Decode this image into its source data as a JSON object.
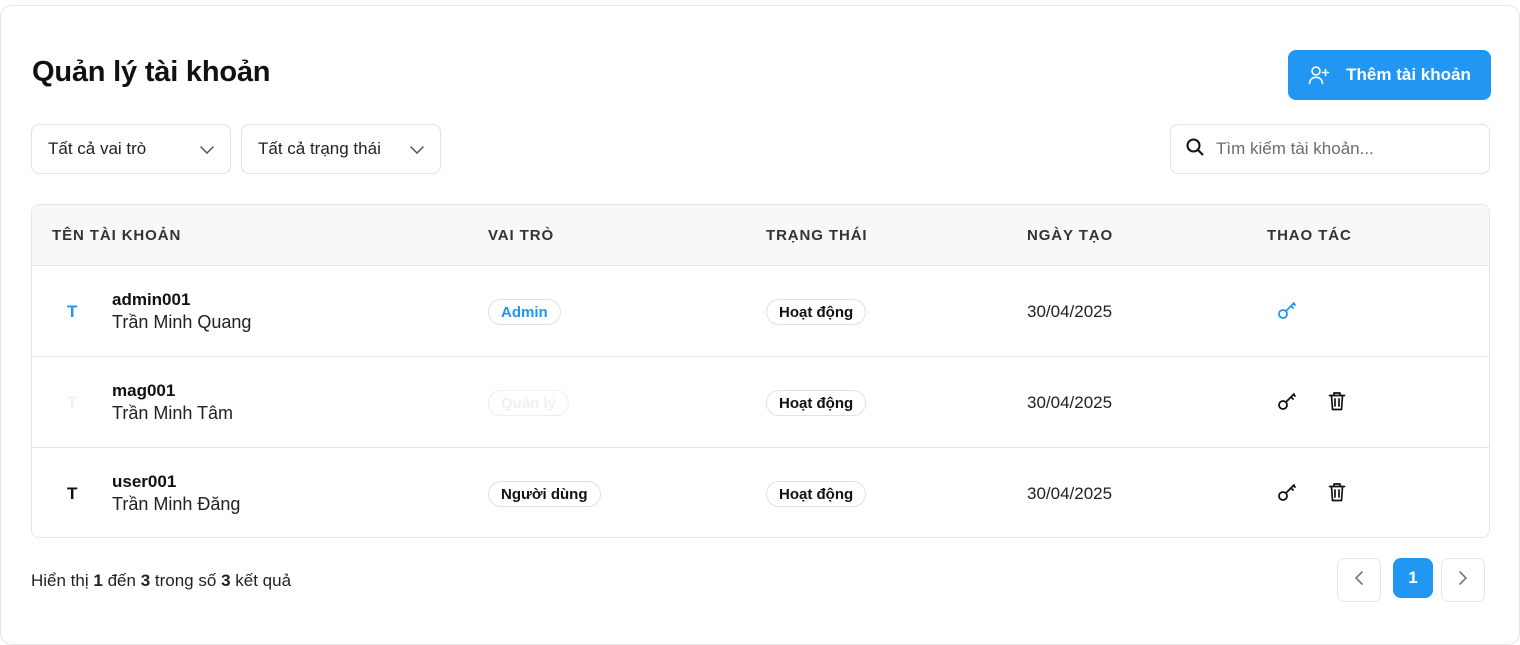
{
  "page": {
    "title": "Quản lý tài khoản",
    "add_button": "Thêm tài khoản"
  },
  "filters": {
    "role": "Tất cả vai trò",
    "status": "Tất cả trạng thái"
  },
  "search": {
    "placeholder": "Tìm kiếm tài khoản..."
  },
  "table": {
    "headers": [
      "TÊN TÀI KHOẢN",
      "VAI TRÒ",
      "TRẠNG THÁI",
      "NGÀY TẠO",
      "THAO TÁC"
    ],
    "rows": [
      {
        "initial": "T",
        "username": "admin001",
        "fullname": "Trần Minh Quang",
        "role": "Admin",
        "status": "Hoạt động",
        "created": "30/04/2025",
        "role_color": "#2196f3",
        "initial_color": "#2196f3",
        "actions": [
          "key-icon"
        ]
      },
      {
        "initial": "T",
        "username": "mag001",
        "fullname": "Trần Minh Tâm",
        "role": "Quản lý",
        "status": "Hoạt động",
        "created": "30/04/2025",
        "role_color": "#f0f0f0",
        "initial_color": "#f0f0f0",
        "actions": [
          "key-icon",
          "trash-icon"
        ]
      },
      {
        "initial": "T",
        "username": "user001",
        "fullname": "Trần Minh Đăng",
        "role": "Người dùng",
        "status": "Hoạt động",
        "created": "30/04/2025",
        "role_color": "#111111",
        "initial_color": "#111111",
        "actions": [
          "key-icon",
          "trash-icon"
        ]
      }
    ]
  },
  "footer": {
    "prefix": "Hiển thị",
    "from": "1",
    "mid1": "đến",
    "to": "3",
    "mid2": "trong số",
    "total": "3",
    "suffix": "kết quả"
  },
  "pagination": {
    "current": "1"
  },
  "colors": {
    "accent": "#2196f3"
  }
}
